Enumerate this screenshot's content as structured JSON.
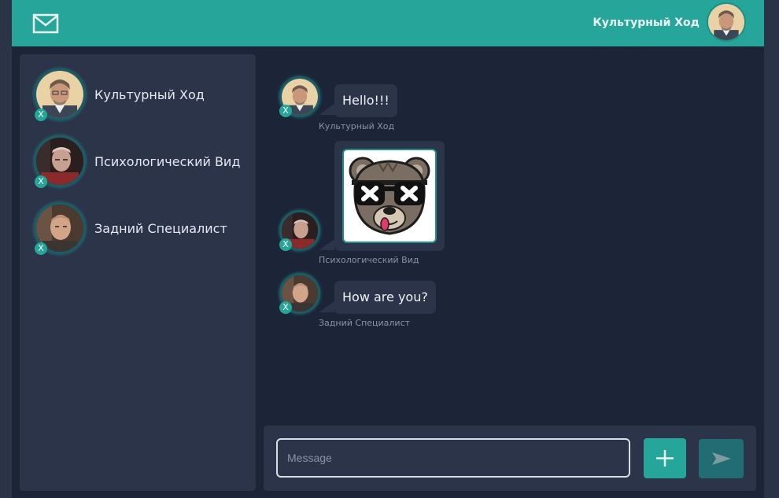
{
  "header": {
    "mail_icon": "mail-icon",
    "current_user": "Культурный Ход",
    "brand_color": "#26a69a"
  },
  "contacts": [
    {
      "name": "Культурный Ход",
      "badge": "X"
    },
    {
      "name": "Психологический Вид",
      "badge": "X"
    },
    {
      "name": "Задний Специалист",
      "badge": "X"
    }
  ],
  "messages": [
    {
      "sender": "Культурный Ход",
      "type": "text",
      "text": "Hello!!!",
      "badge": "X"
    },
    {
      "sender": "Психологический Вид",
      "type": "sticker",
      "sticker": "bear-with-sunglasses-sticker",
      "badge": "X"
    },
    {
      "sender": "Задний Специалист",
      "type": "text",
      "text": "How are you?",
      "badge": "X"
    }
  ],
  "composer": {
    "placeholder": "Message",
    "add_icon": "plus-icon",
    "send_icon": "send-icon"
  }
}
